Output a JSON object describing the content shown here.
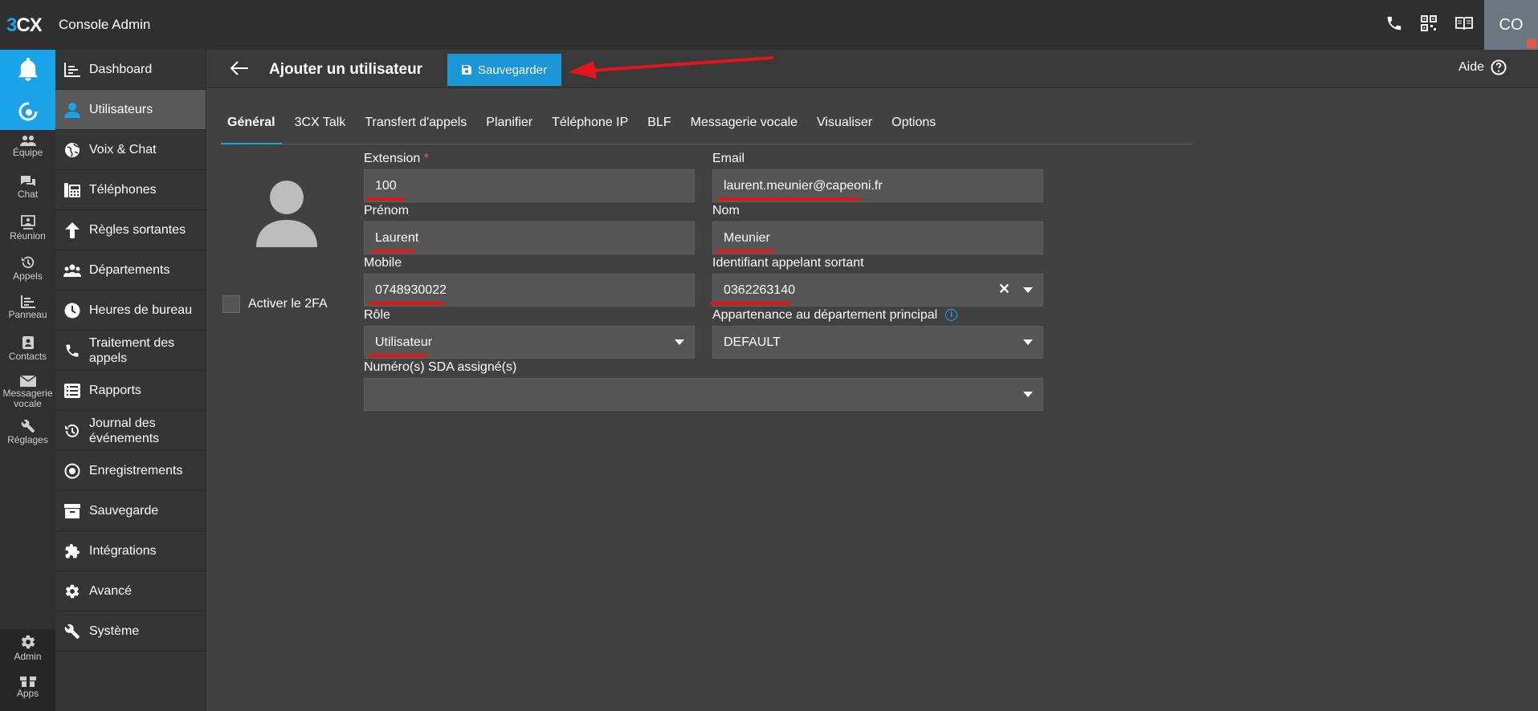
{
  "app": {
    "logo_3": "3",
    "logo_cx": "CX",
    "title": "Console Admin",
    "user_initials": "CO"
  },
  "rail": {
    "items": [
      {
        "label": "Équipe",
        "icon": "team-icon"
      },
      {
        "label": "Chat",
        "icon": "chat-icon"
      },
      {
        "label": "Réunion",
        "icon": "meeting-icon"
      },
      {
        "label": "Appels",
        "icon": "history-icon"
      },
      {
        "label": "Panneau",
        "icon": "panel-icon"
      },
      {
        "label": "Contacts",
        "icon": "contacts-icon"
      },
      {
        "label": "Messagerie vocale",
        "icon": "mail-icon"
      },
      {
        "label": "Réglages",
        "icon": "wrench-icon"
      }
    ],
    "bottom": [
      {
        "label": "Admin",
        "icon": "gear-icon"
      },
      {
        "label": "Apps",
        "icon": "apps-icon"
      }
    ]
  },
  "nav": {
    "items": [
      {
        "label": "Dashboard",
        "icon": "dashboard-icon"
      },
      {
        "label": "Utilisateurs",
        "icon": "user-icon"
      },
      {
        "label": "Voix & Chat",
        "icon": "globe-icon"
      },
      {
        "label": "Téléphones",
        "icon": "phone-device-icon"
      },
      {
        "label": "Règles sortantes",
        "icon": "arrow-up-icon"
      },
      {
        "label": "Départements",
        "icon": "group-icon"
      },
      {
        "label": "Heures de bureau",
        "icon": "clock-icon"
      },
      {
        "label": "Traitement des appels",
        "icon": "phone-icon"
      },
      {
        "label": "Rapports",
        "icon": "report-icon"
      },
      {
        "label": "Journal des événements",
        "icon": "history-icon"
      },
      {
        "label": "Enregistrements",
        "icon": "record-icon"
      },
      {
        "label": "Sauvegarde",
        "icon": "archive-icon"
      },
      {
        "label": "Intégrations",
        "icon": "puzzle-icon"
      },
      {
        "label": "Avancé",
        "icon": "gear-icon"
      },
      {
        "label": "Système",
        "icon": "wrench-icon"
      }
    ]
  },
  "header": {
    "title": "Ajouter un utilisateur",
    "save_label": "Sauvegarder",
    "help_label": "Aide"
  },
  "tabs": [
    "Général",
    "3CX Talk",
    "Transfert d'appels",
    "Planifier",
    "Téléphone IP",
    "BLF",
    "Messagerie vocale",
    "Visualiser",
    "Options"
  ],
  "form": {
    "twofa_label": "Activer le 2FA",
    "extension": {
      "label": "Extension",
      "required": "*",
      "value": "100"
    },
    "email": {
      "label": "Email",
      "value": "laurent.meunier@capeoni.fr"
    },
    "prenom": {
      "label": "Prénom",
      "value": "Laurent"
    },
    "nom": {
      "label": "Nom",
      "value": "Meunier"
    },
    "mobile": {
      "label": "Mobile",
      "value": "0748930022"
    },
    "caller_id": {
      "label": "Identifiant appelant sortant",
      "value": "0362263140",
      "clear": "✕"
    },
    "role": {
      "label": "Rôle",
      "value": "Utilisateur"
    },
    "department": {
      "label": "Appartenance au département principal",
      "value": "DEFAULT",
      "info": "i"
    },
    "did": {
      "label": "Numéro(s) SDA assigné(s)",
      "value": ""
    }
  },
  "colors": {
    "accent": "#1aa3e8",
    "annotation": "#e0161f"
  }
}
